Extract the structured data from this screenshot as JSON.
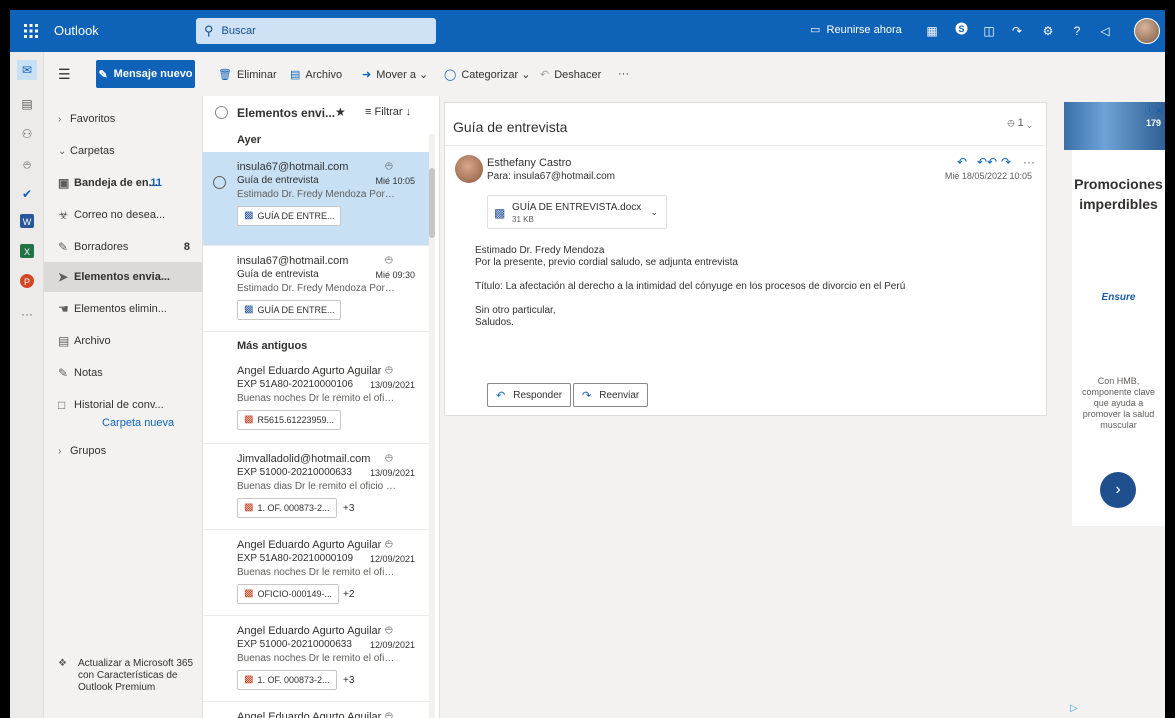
{
  "topbar": {
    "app_name": "Outlook",
    "search_placeholder": "Buscar",
    "meet_now": "Reunirse ahora",
    "help": "?"
  },
  "command_bar": {
    "new_message": "Mensaje nuevo",
    "delete": "Eliminar",
    "archive": "Archivo",
    "move_to": "Mover a",
    "categorize": "Categorizar",
    "undo": "Deshacer",
    "more": "···"
  },
  "folders": {
    "favorites": "Favoritos",
    "folders_header": "Carpetas",
    "items": [
      {
        "label": "Bandeja de en...",
        "count": "11"
      },
      {
        "label": "Correo no desea...",
        "count": ""
      },
      {
        "label": "Borradores",
        "count": "8"
      },
      {
        "label": "Elementos envia...",
        "count": ""
      },
      {
        "label": "Elementos elimin...",
        "count": ""
      },
      {
        "label": "Archivo",
        "count": ""
      },
      {
        "label": "Notas",
        "count": ""
      },
      {
        "label": "Historial de conv...",
        "count": ""
      }
    ],
    "new_folder": "Carpeta nueva",
    "groups": "Grupos",
    "upgrade": "Actualizar a Microsoft 365 con Características de Outlook Premium"
  },
  "message_list": {
    "title": "Elementos envi...",
    "filter": "Filtrar",
    "group_yesterday": "Ayer",
    "group_older": "Más antiguos",
    "messages": [
      {
        "sender": "insula67@hotmail.com",
        "subject": "Guía de entrevista",
        "date": "Mié 10:05",
        "preview": "Estimado Dr. Fredy Mendoza Por la ...",
        "attachment": "GUÍA DE ENTRE...",
        "more": ""
      },
      {
        "sender": "insula67@hotmail.com",
        "subject": "Guía de entrevista",
        "date": "Mié 09:30",
        "preview": "Estimado Dr. Fredy Mendoza Por la ...",
        "attachment": "GUÍA DE ENTRE...",
        "more": ""
      },
      {
        "sender": "Angel Eduardo Agurto Aguilar",
        "subject": "EXP 51A80-20210000106",
        "date": "13/09/2021",
        "preview": "Buenas noches Dr le remito el oficio ...",
        "attachment": "R5615.61223959...",
        "more": ""
      },
      {
        "sender": "Jimvalladolid@hotmail.com",
        "subject": "EXP 51000-20210000633",
        "date": "13/09/2021",
        "preview": "Buenas dias Dr le remito el oficio No ...",
        "attachment": "1. OF. 000873-2...",
        "more": "+3"
      },
      {
        "sender": "Angel Eduardo Agurto Aguilar",
        "subject": "EXP 51A80-20210000109",
        "date": "12/09/2021",
        "preview": "Buenas noches Dr le remito el oficio ...",
        "attachment": "OFICIO-000149-...",
        "more": "+2"
      },
      {
        "sender": "Angel Eduardo Agurto Aguilar",
        "subject": "EXP 51000-20210000633",
        "date": "12/09/2021",
        "preview": "Buenas noches Dr le remito el oficio ...",
        "attachment": "1. OF. 000873-2...",
        "more": "+3"
      },
      {
        "sender": "Angel Eduardo Agurto Aguilar",
        "subject": "",
        "date": "",
        "preview": "",
        "attachment": "",
        "more": ""
      }
    ]
  },
  "reading_pane": {
    "subject": "Guía de entrevista",
    "attachment_count": "1",
    "from": "Esthefany Castro",
    "to": "Para: insula67@hotmail.com",
    "date": "Mié 18/05/2022 10:05",
    "attachment_name": "GUÍA DE ENTREVISTA.docx",
    "attachment_size": "31 KB",
    "body": [
      "Estimado Dr. Fredy Mendoza",
      "Por la presente, previo cordial saludo, se adjunta entrevista",
      "",
      "Título: La afectación al derecho a la intimidad del cónyuge en los procesos de divorcio en el Perú",
      "",
      "Sin otro particular,",
      "Saludos."
    ],
    "reply": "Responder",
    "forward": "Reenviar"
  },
  "ad": {
    "price": "179",
    "title": "Promociones imperdibles",
    "brand": "Ensure",
    "text": "Con HMB, componente clave que ayuda a promover la salud muscular"
  },
  "colors": {
    "brand": "#0e63b8",
    "selected_message": "#c7e0f4",
    "selected_folder": "#dcdad8"
  },
  "icons": [
    "waffle-icon",
    "search-icon",
    "meet-icon",
    "apps-icon",
    "skype-icon",
    "word-icon",
    "feedback-icon",
    "settings-icon",
    "help-icon",
    "megaphone-icon",
    "mail-icon",
    "calendar-icon",
    "people-icon",
    "attach-icon",
    "todo-icon",
    "word-app-icon",
    "excel-app-icon",
    "powerpoint-app-icon",
    "more-apps-icon"
  ]
}
